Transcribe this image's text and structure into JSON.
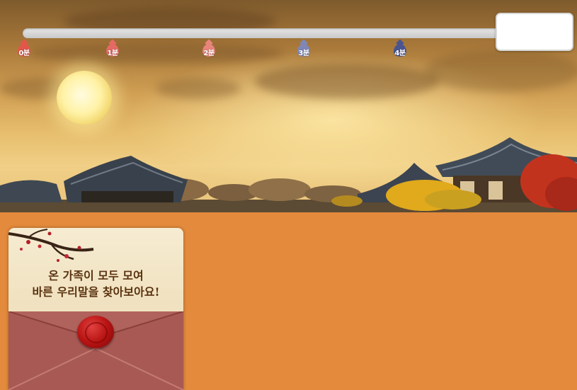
{
  "timer": {
    "markers": [
      {
        "label": "0분",
        "color": "#e2574a"
      },
      {
        "label": "1분",
        "color": "#e46a63"
      },
      {
        "label": "2분",
        "color": "#e8857b"
      },
      {
        "label": "3분",
        "color": "#7f87b8"
      },
      {
        "label": "4분",
        "color": "#4a5590"
      }
    ],
    "progress": 0
  },
  "score": {
    "value": ""
  },
  "invitation": {
    "line1": "온 가족이 모두 모여",
    "line2": "바른 우리말을 찾아보아요!"
  },
  "colors": {
    "background": "#e38a3c",
    "seal": "#b81414",
    "envelope": "#b0625c"
  }
}
